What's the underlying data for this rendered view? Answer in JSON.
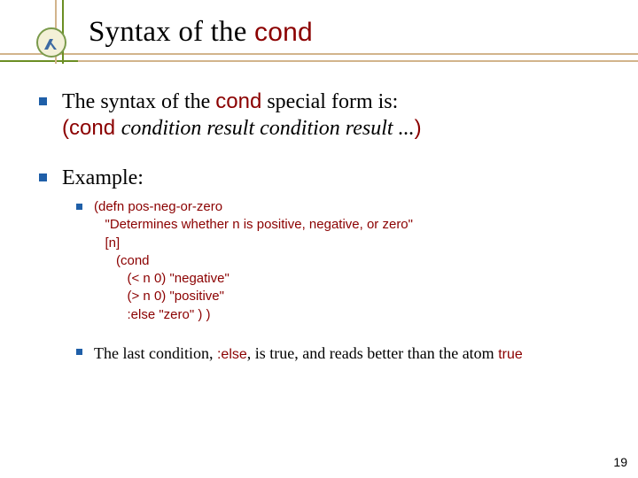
{
  "header": {
    "title_prefix": "Syntax of the ",
    "title_code": "cond"
  },
  "body": {
    "b1_line1a": "The syntax of the ",
    "b1_line1b": "cond",
    "b1_line1c": " special form is:",
    "b1_line2a": "(cond ",
    "b1_line2b": " condition result condition result ...",
    "b1_line2c": ")",
    "b2_label": "Example:",
    "code_text": "(defn pos-neg-or-zero\n   \"Determines whether n is positive, negative, or zero\"\n   [n]\n      (cond\n         (< n 0) \"negative\"\n         (> n 0) \"positive\"\n         :else \"zero\" ) )",
    "note_a": "The last condition, ",
    "note_b": ":else",
    "note_c": ", is true, and reads better than the atom  ",
    "note_d": "true"
  },
  "page_number": "19"
}
